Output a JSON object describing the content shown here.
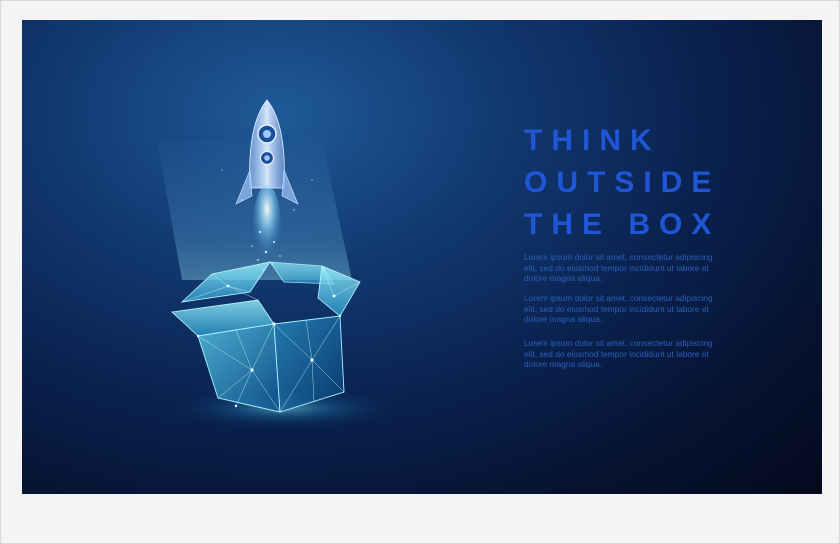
{
  "poster": {
    "headline": [
      "THINK",
      "OUTSIDE",
      "THE BOX"
    ],
    "paragraphs": [
      "Lorem ipsum dolor sit amet, consectetur adipiscing elit, sed do eiusmod tempor incididunt ut labore et dolore magna aliqua.",
      "Lorem ipsum dolor sit amet, consectetur adipiscing elit, sed do eiusmod tempor incididunt ut labore et dolore magna aliqua.",
      "Lorem ipsum dolor sit amet, consectetur adipiscing elit, sed do eiusmod tempor incididunt ut labore et dolore magna aliqua."
    ],
    "colors": {
      "background_light": "#1f5a98",
      "background_dark": "#040a1e",
      "headline": "#1e56d6",
      "body_text": "#2c5fb9",
      "box_glow": "#7ff3ff",
      "rocket": "#cfe3ff"
    },
    "icons": [
      "rocket-icon",
      "open-box-icon"
    ]
  }
}
